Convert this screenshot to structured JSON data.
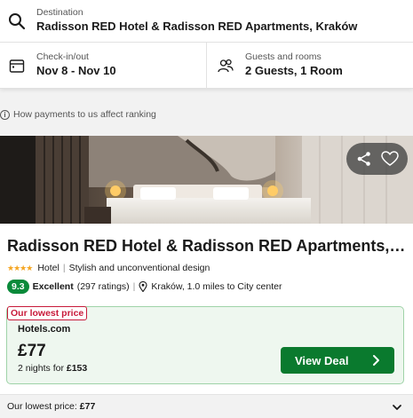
{
  "search": {
    "destination_label": "Destination",
    "destination_value": "Radisson RED Hotel & Radisson RED Apartments, Kraków",
    "checkin_label": "Check-in/out",
    "checkin_value": "Nov 8 - Nov 10",
    "guests_label": "Guests and rooms",
    "guests_value": "2 Guests, 1 Room"
  },
  "payments_note": "How payments to us affect ranking",
  "hotel": {
    "name": "Radisson RED Hotel & Radisson RED Apartments, K...",
    "stars": 4,
    "type": "Hotel",
    "tagline": "Stylish and unconventional design",
    "score": "9.3",
    "rating_word": "Excellent",
    "rating_count": "(297 ratings)",
    "location": "Kraków, 1.0 miles to City center"
  },
  "deal": {
    "badge": "Our lowest price",
    "provider": "Hotels.com",
    "price": "£77",
    "nights_prefix": "2 nights for",
    "nights_total": "£153",
    "button": "View Deal"
  },
  "footer": {
    "label": "Our lowest price:",
    "value": "£77"
  },
  "colors": {
    "accent_green": "#0a7a2e",
    "score_green": "#0a8a3a",
    "badge_red": "#c81a3a",
    "star_gold": "#f5a623"
  }
}
